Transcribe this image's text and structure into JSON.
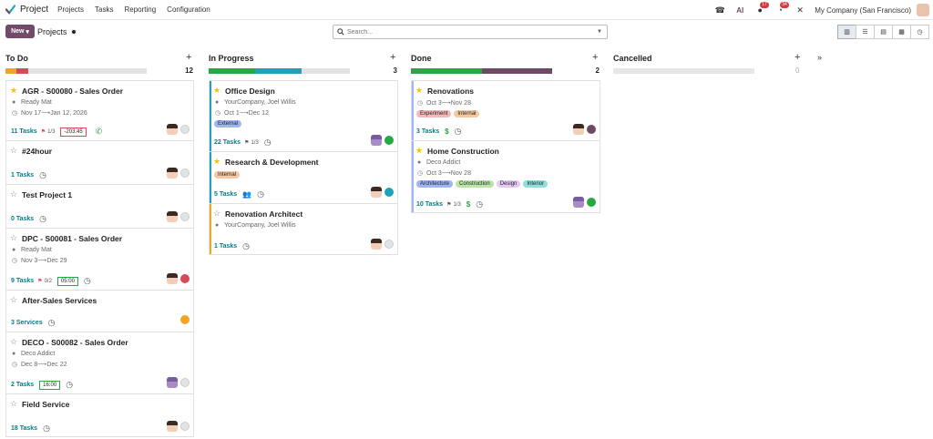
{
  "app": {
    "title": "Project",
    "brand_color": "#714b67",
    "accent": "#017e84"
  },
  "menu": [
    "Projects",
    "Tasks",
    "Reporting",
    "Configuration"
  ],
  "systray": {
    "chat_badge": "17",
    "activity_badge": "34",
    "company": "My Company (San Francisco)"
  },
  "control": {
    "new_label": "New",
    "breadcrumb": "Projects",
    "search_placeholder": "Search..."
  },
  "views": [
    "kanban-icon",
    "list-icon",
    "gantt-icon",
    "calendar-icon",
    "activity-icon"
  ],
  "columns": [
    {
      "title": "To Do",
      "count": "12",
      "progress": [
        {
          "color": "#f0a623",
          "pct": 8
        },
        {
          "color": "#d44c59",
          "pct": 8
        },
        {
          "color": "#e2e2e2",
          "pct": 84
        }
      ],
      "cards": [
        {
          "title": "AGR - S00080 - Sales Order",
          "star": true,
          "customer": "Ready Mat",
          "start": "Nov 17",
          "end": "Jan 12, 2026",
          "tasks": "11 Tasks",
          "milestone": "1/3",
          "timer": "-203:45",
          "timer_color": "#d44c59",
          "phone": true,
          "status": "#e3e3e3",
          "height": 66
        },
        {
          "title": "#24hour",
          "star": false,
          "tasks": "1 Tasks",
          "status": "#e3e3e3",
          "height": 48
        },
        {
          "title": "Test Project 1",
          "star": false,
          "tasks": "0 Tasks",
          "status": "#e3e3e3",
          "height": 48
        },
        {
          "title": "DPC - S00081 - Sales Order",
          "star": false,
          "customer": "Ready Mat",
          "start": "Nov 3",
          "end": "Dec 29",
          "tasks": "9 Tasks",
          "milestone": "0/2",
          "timer": "05:00",
          "timer_color": "#28a745",
          "status": "#d44c59",
          "height": 68
        },
        {
          "title": "After-Sales Services",
          "star": false,
          "tasks": "3 Services",
          "status": "#f0a623",
          "no_avatar": true,
          "height": 46
        },
        {
          "title": "DECO - S00082 - Sales Order",
          "star": false,
          "customer": "Deco Addict",
          "start": "Dec 8",
          "end": "Dec 22",
          "tasks": "2 Tasks",
          "timer": "16:00",
          "timer_color": "#28a745",
          "status": "#e3e3e3",
          "purple_avatar": true,
          "height": 68
        },
        {
          "title": "Field Service",
          "star": false,
          "tasks": "18 Tasks",
          "status": "#e3e3e3",
          "height": 48
        }
      ]
    },
    {
      "title": "In Progress",
      "count": "3",
      "progress": [
        {
          "color": "#28a745",
          "pct": 33
        },
        {
          "color": "#1ea3b8",
          "pct": 33
        },
        {
          "color": "#e2e2e2",
          "pct": 34
        }
      ],
      "cards": [
        {
          "title": "Office Design",
          "star": true,
          "customer": "YourCompany, Joel Willis",
          "start": "Oct 1",
          "end": "Dec 12",
          "tags": [
            {
              "label": "External",
              "color": "#9eb4f5"
            }
          ],
          "tasks": "22 Tasks",
          "milestone": "1/3",
          "status": "#28a745",
          "purple_avatar": true,
          "bar": "#1ea3b8",
          "height": 78
        },
        {
          "title": "Research & Development",
          "star": true,
          "tags": [
            {
              "label": "Internal",
              "color": "#f5c8a0"
            }
          ],
          "tasks": "5 Tasks",
          "people": true,
          "status": "#1ea3b8",
          "bar": "#1ea3b8",
          "height": 57
        },
        {
          "title": "Renovation Architect",
          "star": false,
          "customer": "YourCompany, Joel Willis",
          "tasks": "1 Tasks",
          "status": "#e3e3e3",
          "bar": "#f0a623",
          "height": 57
        }
      ]
    },
    {
      "title": "Done",
      "count": "2",
      "progress": [
        {
          "color": "#28a745",
          "pct": 50
        },
        {
          "color": "#6e4a62",
          "pct": 50
        }
      ],
      "cards": [
        {
          "title": "Renovations",
          "star": true,
          "start": "Oct 3",
          "end": "Nov 28",
          "tags": [
            {
              "label": "Experiment",
              "color": "#f5b8b8"
            },
            {
              "label": "Internal",
              "color": "#f5c8a0"
            }
          ],
          "tasks": "3 Tasks",
          "dollar": true,
          "status": "#6e4a62",
          "bar": "#9eb4f5",
          "height": 66
        },
        {
          "title": "Home Construction",
          "star": true,
          "customer": "Deco Addict",
          "start": "Oct 3",
          "end": "Nov 28",
          "tags": [
            {
              "label": "Architecture",
              "color": "#9eb4f5"
            },
            {
              "label": "Construction",
              "color": "#b8e6a8"
            },
            {
              "label": "Design",
              "color": "#e6c8f5"
            },
            {
              "label": "Interior",
              "color": "#8fe0d8"
            }
          ],
          "tasks": "10 Tasks",
          "milestone": "1/3",
          "dollar": true,
          "status": "#28a745",
          "purple_avatar": true,
          "bar": "#9eb4f5",
          "height": 80
        }
      ]
    },
    {
      "title": "Cancelled",
      "count": "0",
      "progress": [
        {
          "color": "#e6e6e6",
          "pct": 100
        }
      ],
      "cards": []
    }
  ],
  "labels": {
    "ready_mat": "Ready Mat",
    "expand": "»"
  }
}
